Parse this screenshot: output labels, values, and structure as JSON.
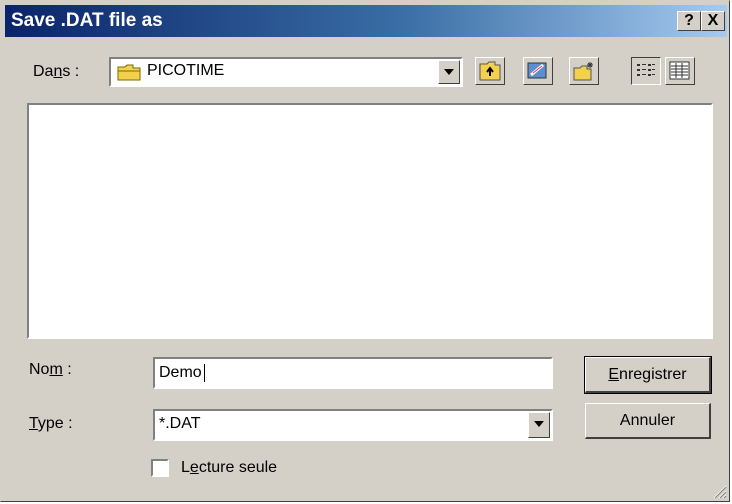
{
  "window": {
    "title": "Save .DAT file as",
    "help_button": "?",
    "close_button": "X"
  },
  "look_in": {
    "label_pre": "Da",
    "label_mnemonic": "n",
    "label_post": "s :",
    "value": "PICOTIME"
  },
  "toolbar": {
    "icons": [
      "up-one-level-icon",
      "desktop-icon",
      "new-folder-icon",
      "list-view-icon",
      "details-view-icon"
    ]
  },
  "file_name": {
    "label_pre": "No",
    "label_mnemonic": "m",
    "label_post": " :",
    "value": "Demo"
  },
  "file_type": {
    "label_mnemonic": "T",
    "label_post": "ype :",
    "value": "*.DAT"
  },
  "buttons": {
    "save_mnemonic": "E",
    "save_rest": "nregistrer",
    "cancel": "Annuler"
  },
  "read_only": {
    "label_pre": "L",
    "label_mnemonic": "e",
    "label_post": "cture seule",
    "checked": false
  }
}
